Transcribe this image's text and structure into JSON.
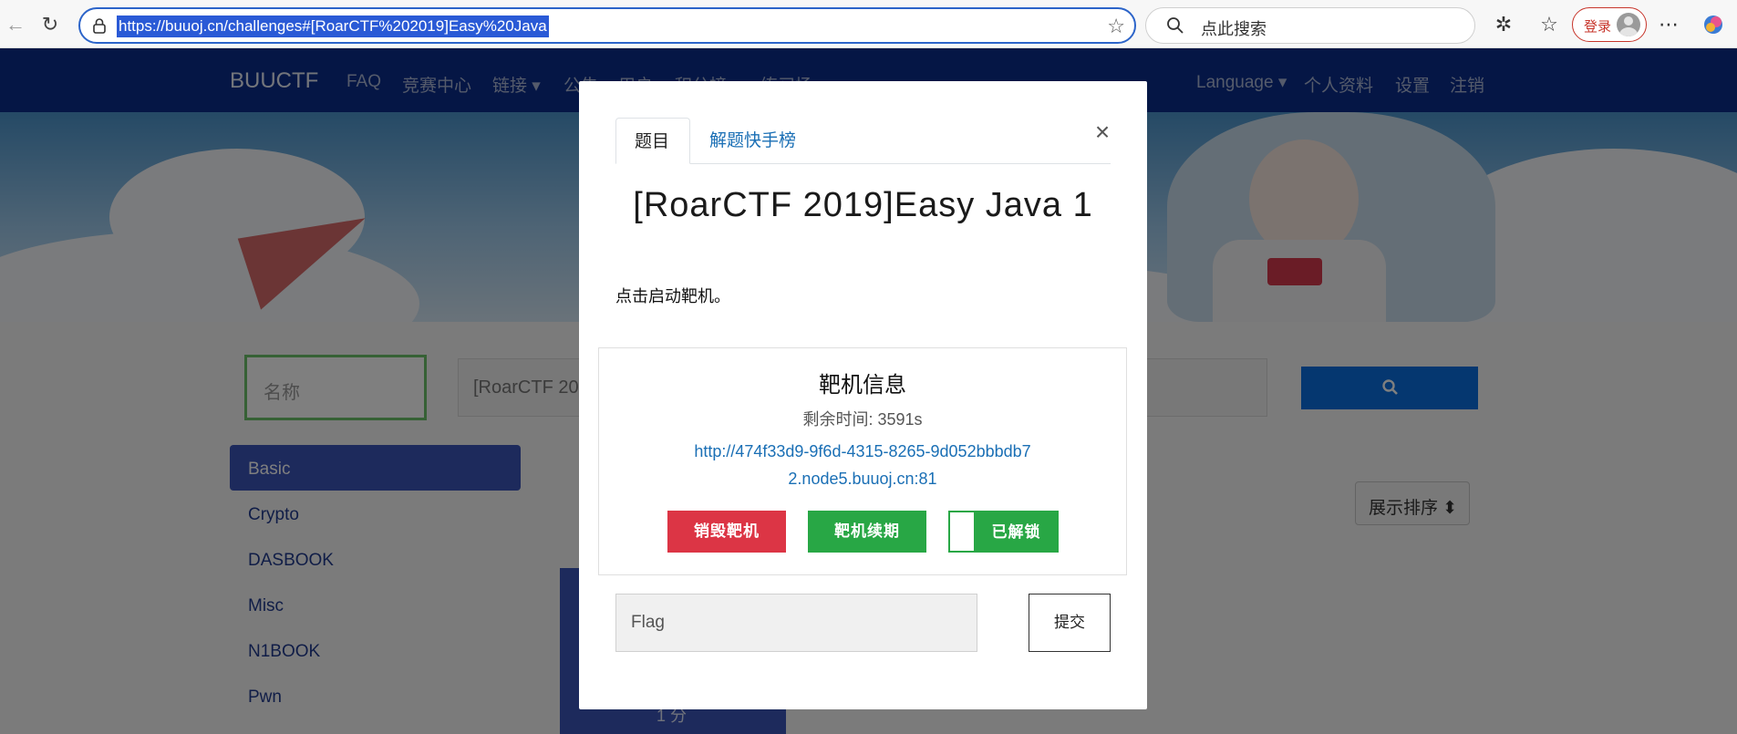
{
  "browser": {
    "url": "https://buuoj.cn/challenges#[RoarCTF%202019]Easy%20Java",
    "search_placeholder": "点此搜索",
    "login_label": "登录"
  },
  "site": {
    "brand": "BUUCTF",
    "nav_left": [
      "FAQ",
      "竞赛中心",
      "链接 ▾",
      "公告",
      "用户",
      "积分榜 ▾",
      "练习场 ▾"
    ],
    "nav_right": [
      "Language ▾",
      "个人资料",
      "设置",
      "注销"
    ],
    "name_placeholder": "名称",
    "search_value": "[RoarCTF 20",
    "categories": [
      "Basic",
      "Crypto",
      "DASBOOK",
      "Misc",
      "N1BOOK",
      "Pwn"
    ],
    "sort_label": "展示排序 ⬍",
    "card_points": "1 分"
  },
  "modal": {
    "tab_challenge": "题目",
    "tab_solves": "解题快手榜",
    "close": "×",
    "title": "[RoarCTF 2019]Easy Java 1",
    "description": "点击启动靶机。",
    "target": {
      "heading": "靶机信息",
      "time_left": "剩余时间: 3591s",
      "link": "http://474f33d9-9f6d-4315-8265-9d052bbbdb72.node5.buuoj.cn:81",
      "btn_destroy": "销毁靶机",
      "btn_renew": "靶机续期",
      "btn_unlocked": "已解锁"
    },
    "flag_placeholder": "Flag",
    "submit_label": "提交"
  }
}
